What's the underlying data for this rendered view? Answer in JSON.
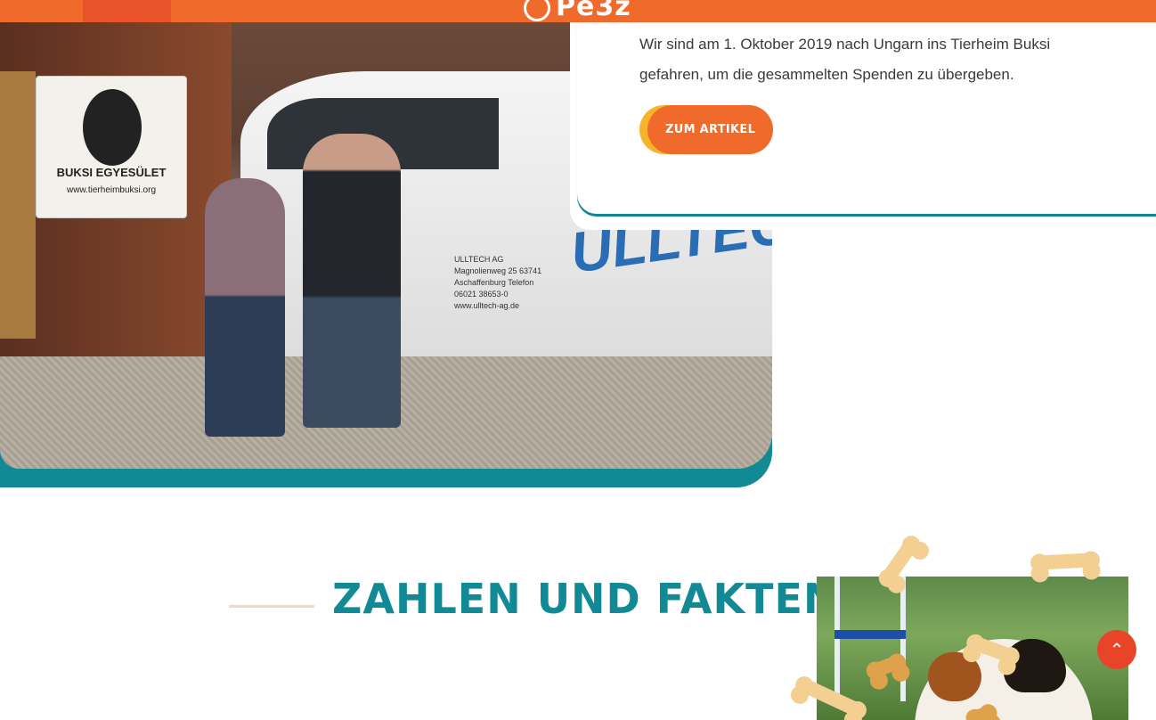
{
  "nav": {
    "logo_text": "Pe3z"
  },
  "hero": {
    "photo_alt": "Zwei Personen vor einem Transporter am Tierheim Buksi",
    "sign_text": "BUKSI EGYESÜLET",
    "sign_url": "www.tierheimbuksi.org",
    "van_brand": "ULLTEC",
    "van_company": "ULLTECH AG Magnolienweg 25 63741 Aschaffenburg Telefon 06021 38653-0 www.ulltech-ag.de"
  },
  "card": {
    "text": "Wir sind am 1. Oktober 2019 nach Ungarn ins Tierheim Buksi gefahren, um die gesammelten Spenden zu übergeben.",
    "button_label": "ZUM ARTIKEL"
  },
  "facts": {
    "heading": "ZAHLEN UND FAKTEN"
  },
  "scroll_top": {
    "icon": "chevron-up-icon",
    "glyph": "⌃"
  },
  "colors": {
    "teal": "#128a96",
    "orange": "#ef6a2b",
    "yellow": "#f7b32b",
    "bone": "#f3cf92",
    "red": "#e8442a"
  }
}
